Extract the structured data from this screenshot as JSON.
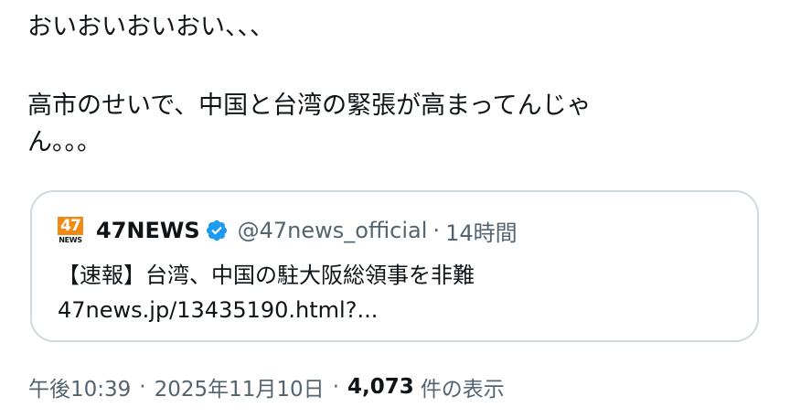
{
  "tweet": {
    "lines": [
      "おいおいおいおい、、、",
      "",
      "高市のせいで、中国と台湾の緊張が高まってんじゃ",
      "ん。。。"
    ]
  },
  "quote": {
    "avatar_top": "47",
    "avatar_bottom": "NEWS",
    "display_name": "47NEWS",
    "verified_icon": "verified-badge-icon",
    "handle": "@47news_official",
    "separator": "·",
    "time_ago": "14時間",
    "text_line1": "【速報】台湾、中国の駐大阪総領事を非難",
    "text_line2": "47news.jp/13435190.html?...",
    "colors": {
      "verified": "#1d9bf0",
      "avatar": "#f08a14",
      "border": "#cfd9de"
    }
  },
  "meta": {
    "time": "午後10:39",
    "separator1": "·",
    "date": "2025年11月10日",
    "separator2": "·",
    "views_count": "4,073",
    "views_label": "件の表示"
  }
}
